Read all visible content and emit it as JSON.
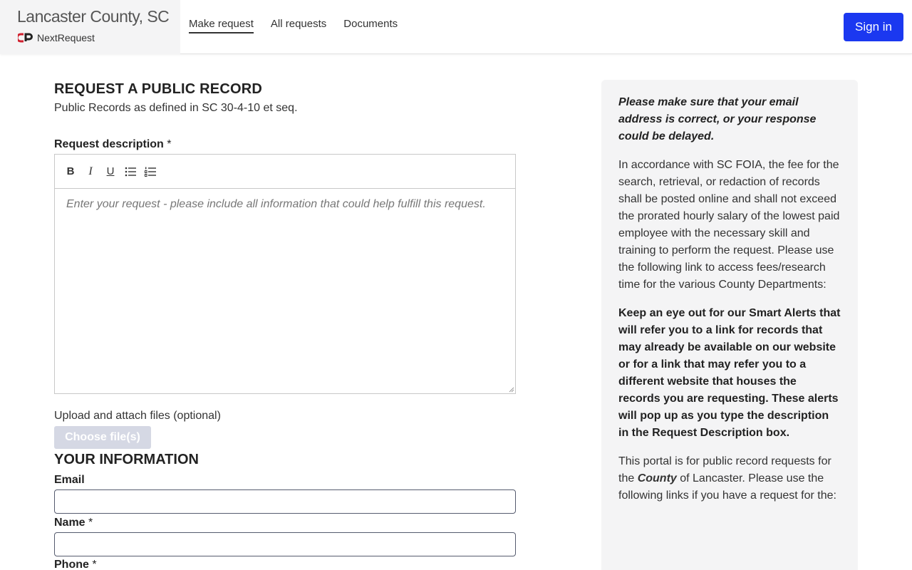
{
  "header": {
    "agency_name": "Lancaster County, SC",
    "brand_name": "NextRequest",
    "nav": [
      {
        "label": "Make request",
        "active": true
      },
      {
        "label": "All requests",
        "active": false
      },
      {
        "label": "Documents",
        "active": false
      }
    ],
    "sign_in_label": "Sign in",
    "sign_in_color": "#1b38f0"
  },
  "form": {
    "title": "REQUEST A PUBLIC RECORD",
    "subtitle": "Public Records as defined in SC 30-4-10 et seq.",
    "description_label": "Request description",
    "required_mark": "*",
    "toolbar": [
      {
        "icon": "bold-icon",
        "glyph": "B"
      },
      {
        "icon": "italic-icon",
        "glyph": "I"
      },
      {
        "icon": "underline-icon",
        "glyph": "U"
      },
      {
        "icon": "bulleted-list-icon",
        "glyph": ""
      },
      {
        "icon": "numbered-list-icon",
        "glyph": ""
      }
    ],
    "description_placeholder": "Enter your request - please include all information that could help fulfill this request.",
    "upload_label": "Upload and attach files (optional)",
    "choose_files_label": "Choose file(s)",
    "your_info_title": "YOUR INFORMATION",
    "email_label": "Email",
    "email_value": "",
    "name_label": "Name",
    "name_value": "",
    "phone_label": "Phone"
  },
  "sidebar": {
    "email_note": "Please make sure that your email address is correct, or your response could be delayed.",
    "fee_text": "In accordance with SC FOIA, the fee for the search, retrieval, or redaction of records shall be posted online and shall not exceed the prorated hourly salary of the lowest paid employee with the necessary skill and training to perform the request. Please use the following link to access fees/research time for the various County Departments:",
    "smart_alerts_text": "Keep an eye out for our Smart Alerts that will refer you to a link for records that may already be available on our website or for a link that may refer you to a different website that houses the records you are requesting. These alerts will pop up as you type the description in the Request Description box.",
    "portal_text_start": "This portal is for public record requests for the ",
    "portal_text_em": "County",
    "portal_text_end": " of Lancaster. Please use the following links if you have a request for the:"
  }
}
